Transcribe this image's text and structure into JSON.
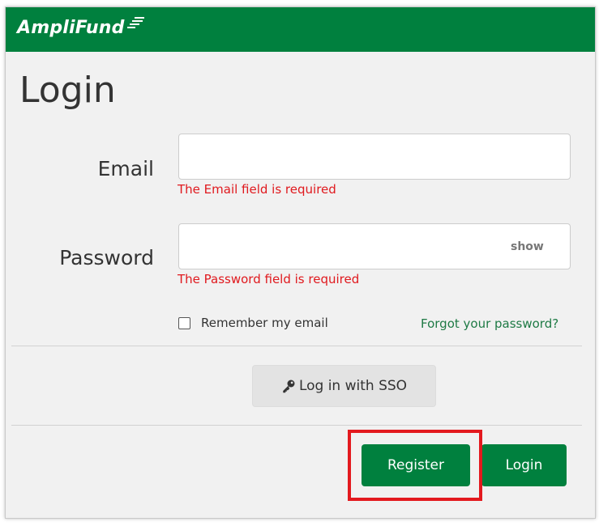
{
  "header": {
    "brand": "AmpliFund",
    "bg_color": "#00803e"
  },
  "page_title": "Login",
  "email": {
    "label": "Email",
    "value": "",
    "placeholder": "",
    "error": "The Email field is required"
  },
  "password": {
    "label": "Password",
    "value": "",
    "placeholder": "",
    "toggle_label": "show",
    "error": "The Password field is required"
  },
  "remember": {
    "label": "Remember my email",
    "checked": false
  },
  "forgot_link": "Forgot your password?",
  "sso_button": {
    "label": "Log in with SSO",
    "icon": "key-icon"
  },
  "buttons": {
    "register": "Register",
    "login": "Login"
  },
  "colors": {
    "primary": "#00803e",
    "error": "#e0191e",
    "highlight": "#e3191e"
  }
}
